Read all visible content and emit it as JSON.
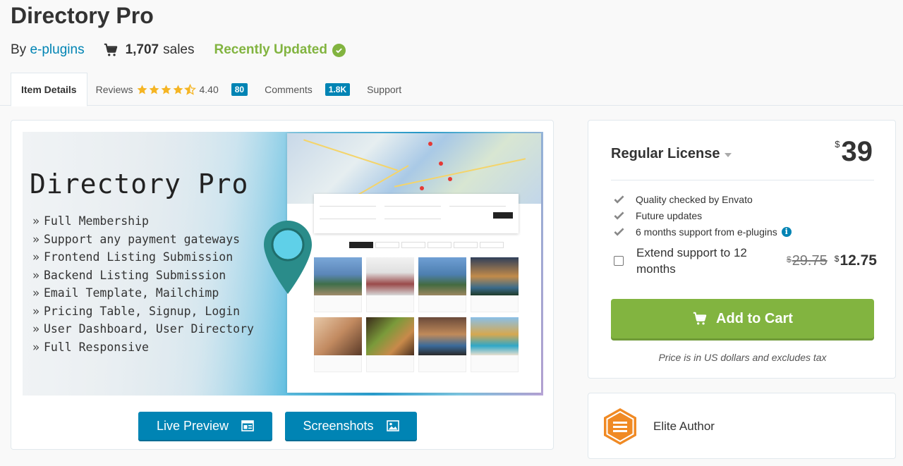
{
  "header": {
    "title": "Directory Pro",
    "by_prefix": "By",
    "author": "e-plugins",
    "sales_count": "1,707",
    "sales_label": "sales",
    "updated_label": "Recently Updated"
  },
  "tabs": {
    "item_details": "Item Details",
    "reviews": "Reviews",
    "rating": "4.40",
    "reviews_count": "80",
    "comments": "Comments",
    "comments_count": "1.8K",
    "support": "Support"
  },
  "rating_stars": 4.4,
  "preview": {
    "banner_title": "Directory Pro",
    "features": [
      "Full Membership",
      "Support any payment gateways",
      "Frontend Listing Submission",
      "Backend Listing Submission",
      "Email Template, Mailchimp",
      "Pricing Table, Signup, Login",
      "User Dashboard, User Directory",
      "Full Responsive"
    ],
    "live_preview": "Live Preview",
    "screenshots": "Screenshots"
  },
  "license": {
    "title": "Regular License",
    "currency": "$",
    "price": "39",
    "checks": [
      "Quality checked by Envato",
      "Future updates",
      "6 months support from e-plugins"
    ],
    "extend_label": "Extend support to 12 months",
    "old_price": "29.75",
    "new_price": "12.75",
    "add_to_cart": "Add to Cart",
    "tax_note": "Price is in US dollars and excludes tax"
  },
  "author_badge": {
    "label": "Elite Author"
  },
  "colors": {
    "accent_blue": "#0084b4",
    "accent_green": "#82b440",
    "star": "#f5b524"
  }
}
